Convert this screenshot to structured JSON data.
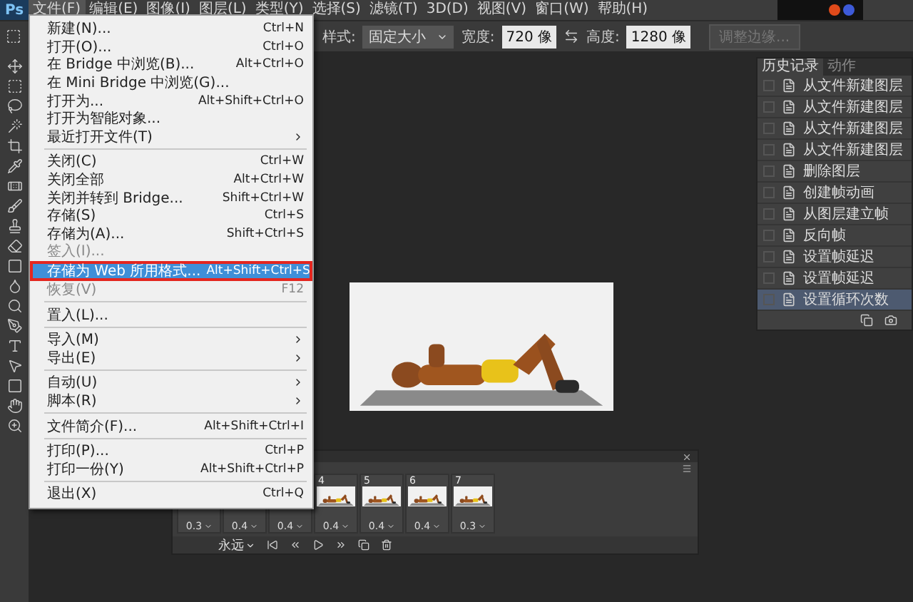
{
  "app": {
    "logo": "Ps"
  },
  "menu_bar": {
    "items": [
      {
        "label": "文件(F)",
        "selected": true
      },
      {
        "label": "编辑(E)",
        "selected": false
      },
      {
        "label": "图像(I)",
        "selected": false
      },
      {
        "label": "图层(L)",
        "selected": false
      },
      {
        "label": "类型(Y)",
        "selected": false
      },
      {
        "label": "选择(S)",
        "selected": false
      },
      {
        "label": "滤镜(T)",
        "selected": false
      },
      {
        "label": "3D(D)",
        "selected": false
      },
      {
        "label": "视图(V)",
        "selected": false
      },
      {
        "label": "窗口(W)",
        "selected": false
      },
      {
        "label": "帮助(H)",
        "selected": false
      }
    ]
  },
  "options_bar": {
    "style_label": "样式:",
    "style_value": "固定大小",
    "width_label": "宽度:",
    "width_value": "720 像",
    "height_label": "高度:",
    "height_value": "1280 像",
    "refine_button": {
      "label": "调整边缘...",
      "disabled": true
    }
  },
  "file_menu": {
    "groups": [
      [
        {
          "label": "新建(N)...",
          "shortcut": "Ctrl+N",
          "submenu": false,
          "disabled": false,
          "selected": false
        },
        {
          "label": "打开(O)...",
          "shortcut": "Ctrl+O",
          "submenu": false,
          "disabled": false,
          "selected": false
        },
        {
          "label": "在 Bridge 中浏览(B)...",
          "shortcut": "Alt+Ctrl+O",
          "submenu": false,
          "disabled": false,
          "selected": false
        },
        {
          "label": "在 Mini Bridge 中浏览(G)...",
          "submenu": false,
          "disabled": false,
          "selected": false
        },
        {
          "label": "打开为...",
          "shortcut": "Alt+Shift+Ctrl+O",
          "submenu": false,
          "disabled": false,
          "selected": false
        },
        {
          "label": "打开为智能对象...",
          "submenu": false,
          "disabled": false,
          "selected": false
        },
        {
          "label": "最近打开文件(T)",
          "submenu": true,
          "disabled": false,
          "selected": false
        }
      ],
      [
        {
          "label": "关闭(C)",
          "shortcut": "Ctrl+W",
          "submenu": false,
          "disabled": false,
          "selected": false
        },
        {
          "label": "关闭全部",
          "shortcut": "Alt+Ctrl+W",
          "submenu": false,
          "disabled": false,
          "selected": false
        },
        {
          "label": "关闭并转到 Bridge...",
          "shortcut": "Shift+Ctrl+W",
          "submenu": false,
          "disabled": false,
          "selected": false
        },
        {
          "label": "存储(S)",
          "shortcut": "Ctrl+S",
          "submenu": false,
          "disabled": false,
          "selected": false
        },
        {
          "label": "存储为(A)...",
          "shortcut": "Shift+Ctrl+S",
          "submenu": false,
          "disabled": false,
          "selected": false
        },
        {
          "label": "签入(I)...",
          "submenu": false,
          "disabled": true,
          "selected": false
        },
        {
          "label": "存储为 Web 所用格式...",
          "shortcut": "Alt+Shift+Ctrl+S",
          "submenu": false,
          "disabled": false,
          "selected": true
        },
        {
          "label": "恢复(V)",
          "shortcut": "F12",
          "submenu": false,
          "disabled": true,
          "selected": false
        }
      ],
      [
        {
          "label": "置入(L)...",
          "submenu": false,
          "disabled": false,
          "selected": false
        }
      ],
      [
        {
          "label": "导入(M)",
          "submenu": true,
          "disabled": false,
          "selected": false
        },
        {
          "label": "导出(E)",
          "submenu": true,
          "disabled": false,
          "selected": false
        }
      ],
      [
        {
          "label": "自动(U)",
          "submenu": true,
          "disabled": false,
          "selected": false
        },
        {
          "label": "脚本(R)",
          "submenu": true,
          "disabled": false,
          "selected": false
        }
      ],
      [
        {
          "label": "文件简介(F)...",
          "shortcut": "Alt+Shift+Ctrl+I",
          "submenu": false,
          "disabled": false,
          "selected": false
        }
      ],
      [
        {
          "label": "打印(P)...",
          "shortcut": "Ctrl+P",
          "submenu": false,
          "disabled": false,
          "selected": false
        },
        {
          "label": "打印一份(Y)",
          "shortcut": "Alt+Shift+Ctrl+P",
          "submenu": false,
          "disabled": false,
          "selected": false
        }
      ],
      [
        {
          "label": "退出(X)",
          "shortcut": "Ctrl+Q",
          "submenu": false,
          "disabled": false,
          "selected": false
        }
      ]
    ]
  },
  "history_panel": {
    "tabs": [
      {
        "label": "历史记录",
        "selected": true
      },
      {
        "label": "动作",
        "selected": false
      }
    ],
    "items": [
      {
        "label": "从文件新建图层",
        "selected": false
      },
      {
        "label": "从文件新建图层",
        "selected": false
      },
      {
        "label": "从文件新建图层",
        "selected": false
      },
      {
        "label": "从文件新建图层",
        "selected": false
      },
      {
        "label": "删除图层",
        "selected": false
      },
      {
        "label": "创建帧动画",
        "selected": false
      },
      {
        "label": "从图层建立帧",
        "selected": false
      },
      {
        "label": "反向帧",
        "selected": false
      },
      {
        "label": "设置帧延迟",
        "selected": false
      },
      {
        "label": "设置帧延迟",
        "selected": false
      },
      {
        "label": "设置循环次数",
        "selected": true
      }
    ]
  },
  "timeline": {
    "frames": [
      {
        "delay": "0.3"
      },
      {
        "delay": "0.4"
      },
      {
        "delay": "0.4"
      },
      {
        "number": "4",
        "delay": "0.4"
      },
      {
        "number": "5",
        "delay": "0.4"
      },
      {
        "number": "6",
        "delay": "0.4"
      },
      {
        "number": "7",
        "delay": "0.3"
      }
    ],
    "loop": "永远"
  }
}
